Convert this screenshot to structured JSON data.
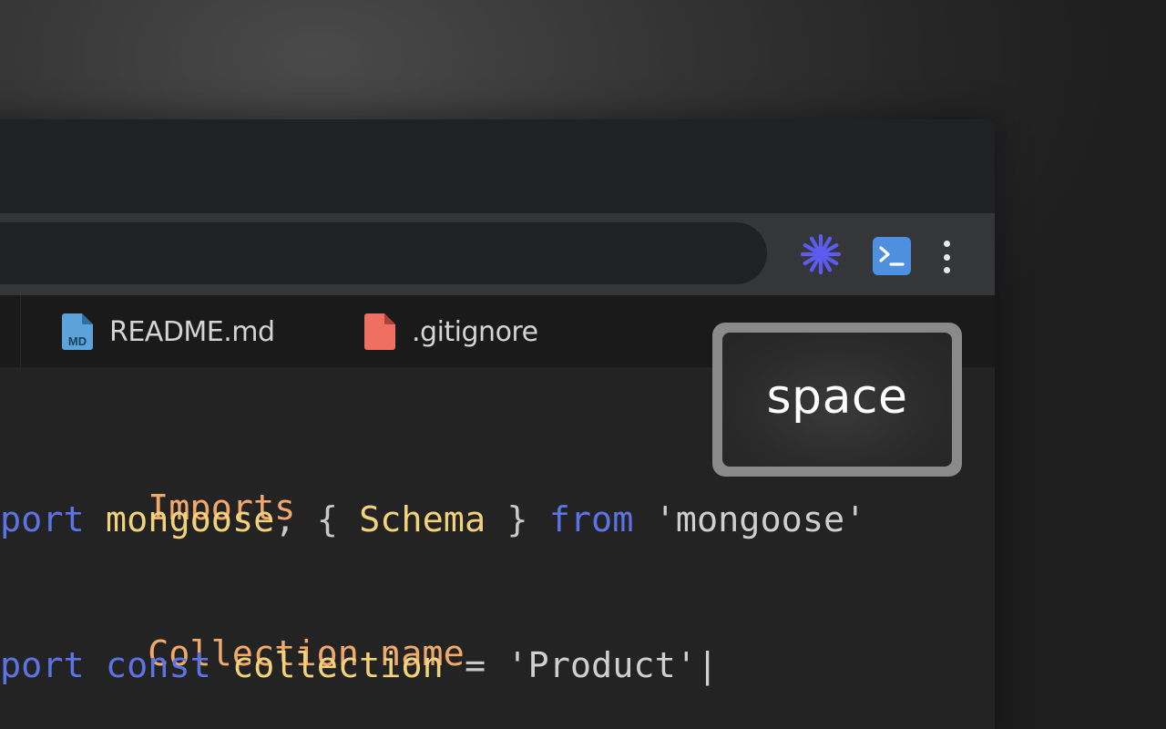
{
  "toolbar": {
    "extensions": [
      {
        "icon": "sunburst-extension-icon",
        "color": "#5b5bf0"
      },
      {
        "icon": "terminal-extension-icon",
        "color": "#4e8fe0"
      }
    ],
    "menu_icon": "vertical-dots-menu-icon"
  },
  "tabs": [
    {
      "label": "README.md",
      "icon": "markdown-file-icon",
      "icon_text": "MD",
      "icon_color": "#5ba3d9"
    },
    {
      "label": ".gitignore",
      "icon": "generic-file-icon",
      "icon_color": "#ef6f62"
    }
  ],
  "code": {
    "line1": {
      "comment": "Imports"
    },
    "line2": {
      "kw1": "port",
      "ident1": "mongoose",
      "punct1": ", { ",
      "ident2": "Schema",
      "punct2": " } ",
      "kw2": "from",
      "str": " 'mongoose'"
    },
    "line4": {
      "comment": "Collection name"
    },
    "line5": {
      "kw1": "port",
      "kw2": "const",
      "ident": "collection",
      "punct": " = ",
      "str": "'Product'",
      "cursor": "|"
    }
  },
  "key_overlay": {
    "label": "space"
  },
  "colors": {
    "comment": "#f0a96a",
    "keyword": "#5c73e6",
    "identifier": "#f2d27a",
    "string": "#cfcfcf"
  }
}
